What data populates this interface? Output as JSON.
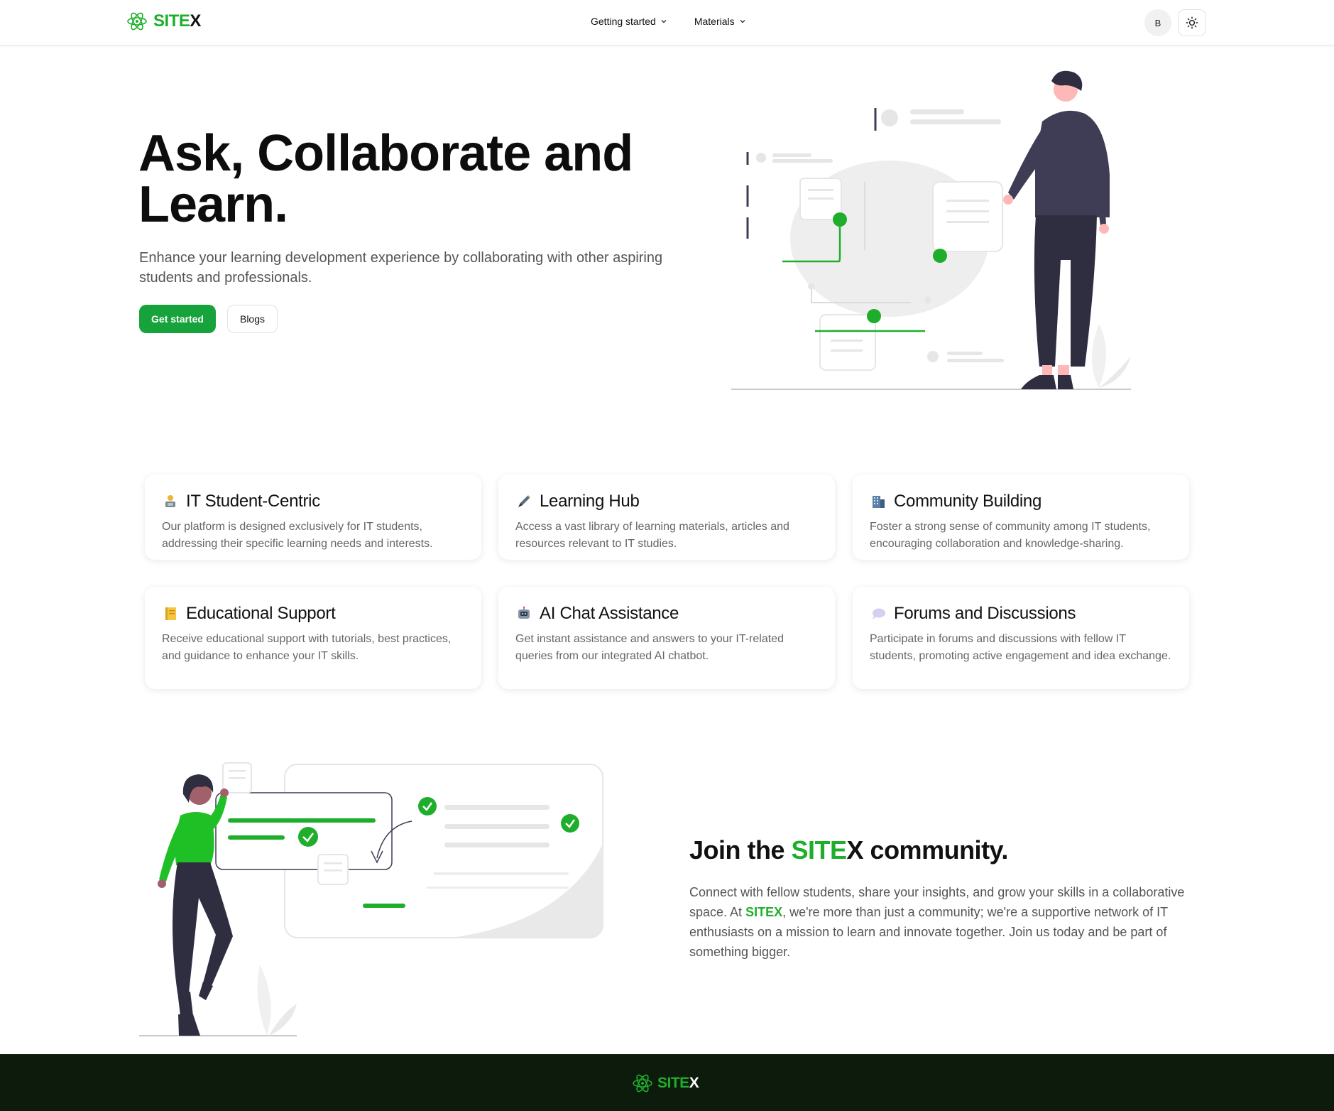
{
  "header": {
    "brand_main": "SITE",
    "brand_accent": "X",
    "nav": [
      {
        "label": "Getting started"
      },
      {
        "label": "Materials"
      }
    ],
    "avatar_initial": "B",
    "theme_icon": "sun-icon"
  },
  "hero": {
    "title": "Ask, Collaborate and Learn.",
    "subtitle": "Enhance your learning development experience by collaborating with other aspiring students and professionals.",
    "primary_button": "Get started",
    "secondary_button": "Blogs"
  },
  "features": [
    {
      "icon": "laptop-person-icon",
      "title": "IT Student-Centric",
      "desc": "Our platform is designed exclusively for IT students, addressing their specific learning needs and interests."
    },
    {
      "icon": "pen-icon",
      "title": "Learning Hub",
      "desc": "Access a vast library of learning materials, articles and resources relevant to IT studies."
    },
    {
      "icon": "building-icon",
      "title": "Community Building",
      "desc": "Foster a strong sense of community among IT students, encouraging collaboration and knowledge-sharing."
    },
    {
      "icon": "notebook-icon",
      "title": "Educational Support",
      "desc": "Receive educational support with tutorials, best practices, and guidance to enhance your IT skills."
    },
    {
      "icon": "robot-icon",
      "title": "AI Chat Assistance",
      "desc": "Get instant assistance and answers to your IT-related queries from our integrated AI chatbot."
    },
    {
      "icon": "speech-bubble-icon",
      "title": "Forums and Discussions",
      "desc": "Participate in forums and discussions with fellow IT students, promoting active engagement and idea exchange."
    }
  ],
  "community": {
    "title_pre": "Join the ",
    "title_brand_main": "SITE",
    "title_brand_accent": "X",
    "title_post": " community.",
    "text_1": "Connect with fellow students, share your insights, and grow your skills in a collaborative space. At ",
    "text_brand": "SITEX",
    "text_2": ", we're more than just a community; we're a supportive network of IT enthusiasts on a mission to learn and innovate together. Join us today and be part of something bigger."
  },
  "footer": {
    "brand_main": "SITE",
    "brand_accent": "X"
  },
  "colors": {
    "accent": "#1fae2c",
    "primary_button": "#17a33c",
    "footer_bg": "#0c1b0b"
  }
}
